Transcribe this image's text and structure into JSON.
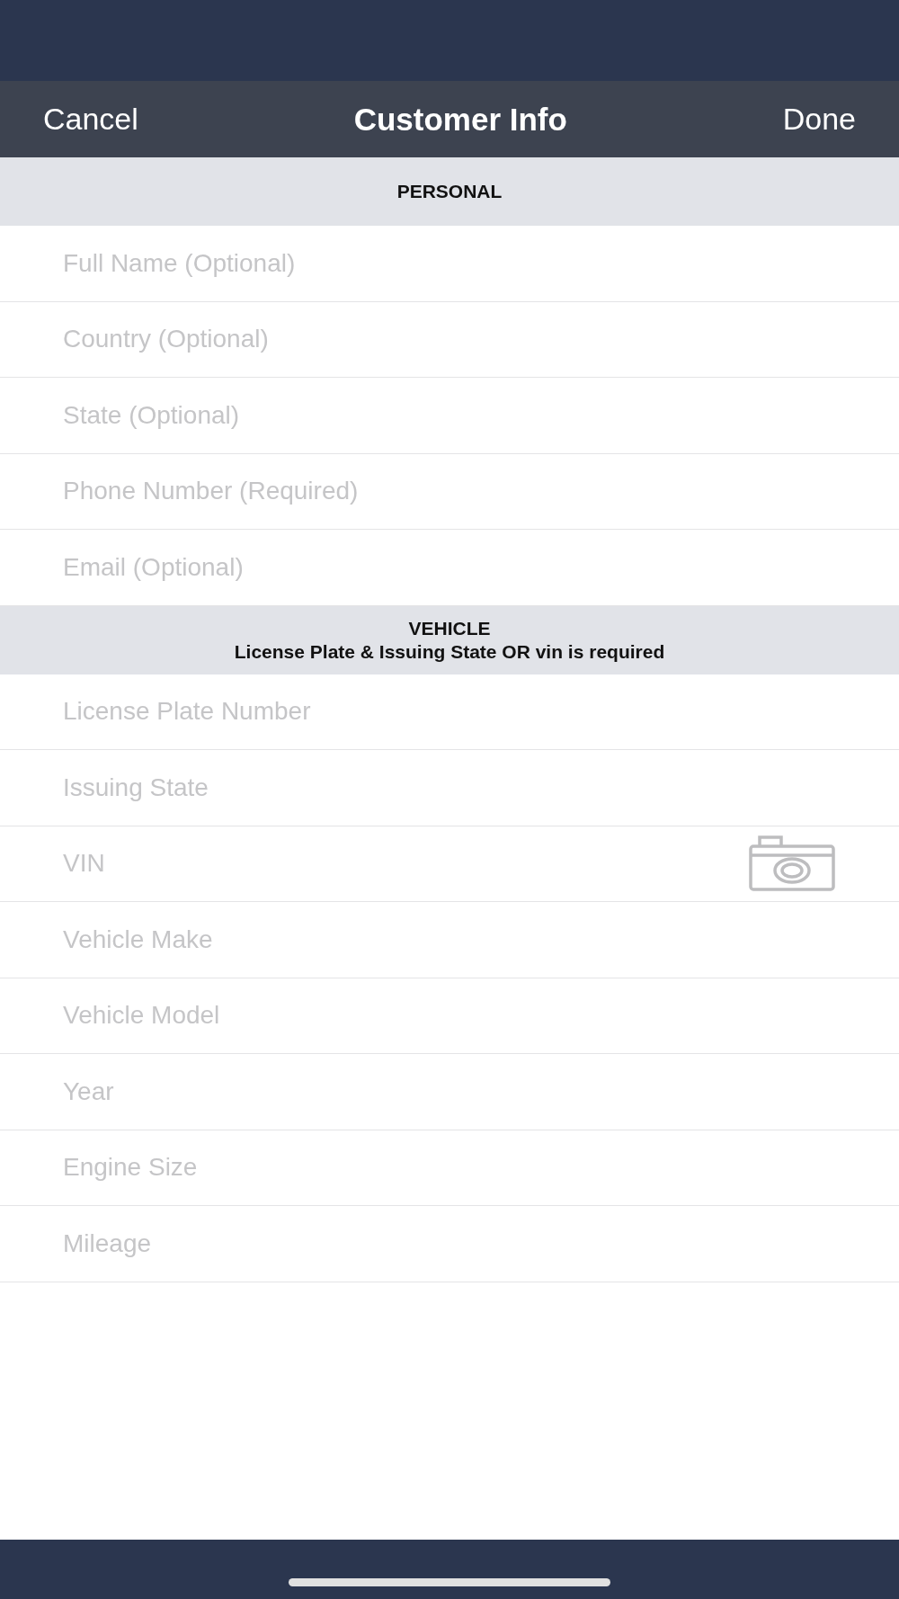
{
  "nav": {
    "cancel": "Cancel",
    "title": "Customer Info",
    "done": "Done"
  },
  "sections": [
    {
      "title": "PERSONAL",
      "fields": [
        {
          "kind": "text",
          "placeholder": "Full Name (Optional)"
        },
        {
          "kind": "text",
          "placeholder": "Country (Optional)"
        },
        {
          "kind": "text",
          "placeholder": "State (Optional)"
        },
        {
          "kind": "text",
          "placeholder": "Phone Number (Required)"
        },
        {
          "kind": "text",
          "placeholder": "Email (Optional)"
        }
      ]
    },
    {
      "title": "VEHICLE",
      "subtitle": "License Plate & Issuing State OR vin is required",
      "fields": [
        {
          "kind": "text",
          "placeholder": "License Plate Number"
        },
        {
          "kind": "text",
          "placeholder": "Issuing State"
        },
        {
          "kind": "scan",
          "placeholder": "VIN"
        },
        {
          "kind": "text",
          "placeholder": "Vehicle Make"
        },
        {
          "kind": "text",
          "placeholder": "Vehicle Model"
        },
        {
          "kind": "text",
          "placeholder": "Year"
        },
        {
          "kind": "text",
          "placeholder": "Engine Size"
        },
        {
          "kind": "text",
          "placeholder": "Mileage"
        }
      ]
    }
  ]
}
